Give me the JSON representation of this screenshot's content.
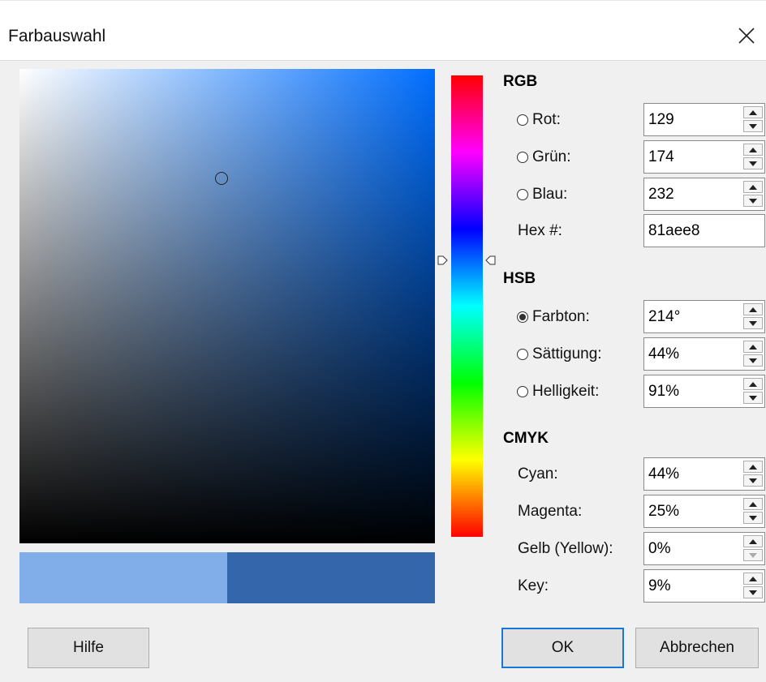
{
  "window": {
    "title": "Farbauswahl"
  },
  "colors": {
    "new_color": "#81aee8",
    "old_color": "#3366aa",
    "hue_value": 214
  },
  "rgb": {
    "heading": "RGB",
    "red": {
      "label": "Rot:",
      "value": "129"
    },
    "green": {
      "label": "Grün:",
      "value": "174"
    },
    "blue": {
      "label": "Blau:",
      "value": "232"
    },
    "hex": {
      "label": "Hex #:",
      "value": "81aee8"
    }
  },
  "hsb": {
    "heading": "HSB",
    "hue": {
      "label": "Farbton:",
      "value": "214°",
      "selected": true
    },
    "saturation": {
      "label": "Sättigung:",
      "value": "44%"
    },
    "brightness": {
      "label": "Helligkeit:",
      "value": "91%"
    }
  },
  "cmyk": {
    "heading": "CMYK",
    "cyan": {
      "label": "Cyan:",
      "value": "44%"
    },
    "magenta": {
      "label": "Magenta:",
      "value": "25%"
    },
    "yellow": {
      "label": "Gelb (Yellow):",
      "value": "0%"
    },
    "key": {
      "label": "Key:",
      "value": "9%"
    }
  },
  "buttons": {
    "help": "Hilfe",
    "ok": "OK",
    "cancel": "Abbrechen"
  },
  "icons": {
    "close": "close-icon",
    "spin_up": "arrow-up-icon",
    "spin_down": "arrow-down-icon"
  }
}
